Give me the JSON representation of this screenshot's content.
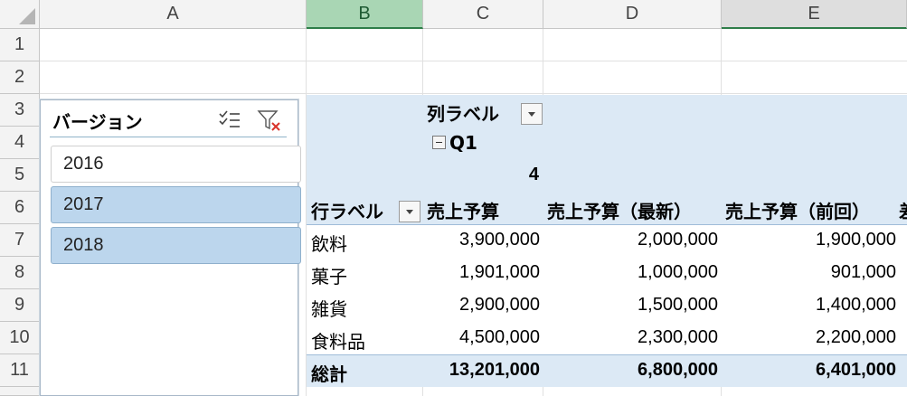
{
  "columns": [
    {
      "id": "A",
      "label": "A"
    },
    {
      "id": "B",
      "label": "B"
    },
    {
      "id": "C",
      "label": "C"
    },
    {
      "id": "D",
      "label": "D"
    },
    {
      "id": "E",
      "label": "E"
    }
  ],
  "rows": [
    "1",
    "2",
    "3",
    "4",
    "5",
    "6",
    "7",
    "8",
    "9",
    "10",
    "11"
  ],
  "slicer": {
    "title": "バージョン",
    "items": [
      {
        "label": "2016",
        "selected": false
      },
      {
        "label": "2017",
        "selected": true
      },
      {
        "label": "2018",
        "selected": true
      }
    ]
  },
  "pivot": {
    "col_label": "列ラベル",
    "quarter": "Q1",
    "month": "4",
    "row_label": "行ラベル",
    "headers": [
      "売上予算",
      "売上予算（最新）",
      "売上予算（前回）"
    ],
    "header_overflow": "差",
    "rows": [
      {
        "label": "飲料",
        "values": [
          "3,900,000",
          "2,000,000",
          "1,900,000"
        ]
      },
      {
        "label": "菓子",
        "values": [
          "1,901,000",
          "1,000,000",
          "901,000"
        ]
      },
      {
        "label": "雑貨",
        "values": [
          "2,900,000",
          "1,500,000",
          "1,400,000"
        ]
      },
      {
        "label": "食料品",
        "values": [
          "4,500,000",
          "2,300,000",
          "2,200,000"
        ]
      }
    ],
    "total": {
      "label": "総計",
      "values": [
        "13,201,000",
        "6,800,000",
        "6,401,000"
      ]
    }
  },
  "colors": {
    "pivot_header_bg": "#dce9f5",
    "slicer_selected": "#bcd6ed",
    "selected_col_header": "#a9d6b4"
  }
}
